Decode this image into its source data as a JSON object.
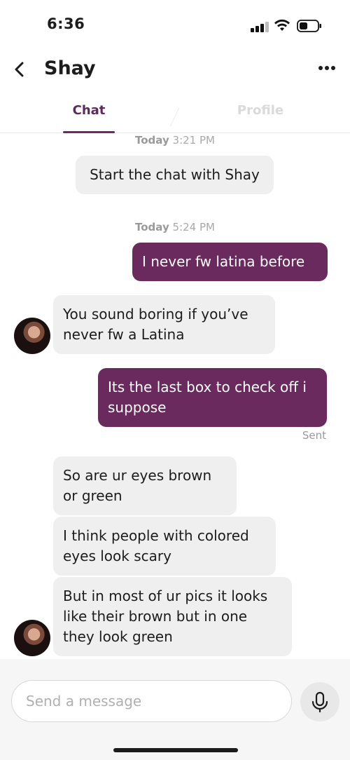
{
  "status_bar": {
    "time": "6:36"
  },
  "header": {
    "back_icon": "chevron-left-icon",
    "contact_name": "Shay",
    "more_icon": "more-horizontal-icon"
  },
  "tabs": [
    {
      "label": "Chat",
      "active": true
    },
    {
      "label": "Profile",
      "active": false
    }
  ],
  "messages": {
    "ts1": {
      "day": "Today",
      "time": "3:21 PM"
    },
    "system": "Start the chat with Shay",
    "ts2": {
      "day": "Today",
      "time": "5:24 PM"
    },
    "m1": {
      "text": "I never fw latina before",
      "from": "me"
    },
    "m2": {
      "text": "You sound boring if you’ve never fw a Latina",
      "from": "Shay"
    },
    "m3": {
      "text": "Its the last box to check off i suppose",
      "from": "me"
    },
    "sent_status": "Sent",
    "m4": {
      "text": "So are ur eyes brown or green",
      "from": "Shay"
    },
    "m5": {
      "text": "I think people with colored eyes look scary",
      "from": "Shay"
    },
    "m6": {
      "text": "But in most of ur pics it looks like their brown but in one they look green",
      "from": "Shay"
    }
  },
  "composer": {
    "placeholder": "Send a message",
    "mic_icon": "microphone-icon"
  },
  "colors": {
    "accent": "#6b2a5e",
    "received_bubble": "#efefef",
    "tab_active": "#5e2a5e"
  }
}
